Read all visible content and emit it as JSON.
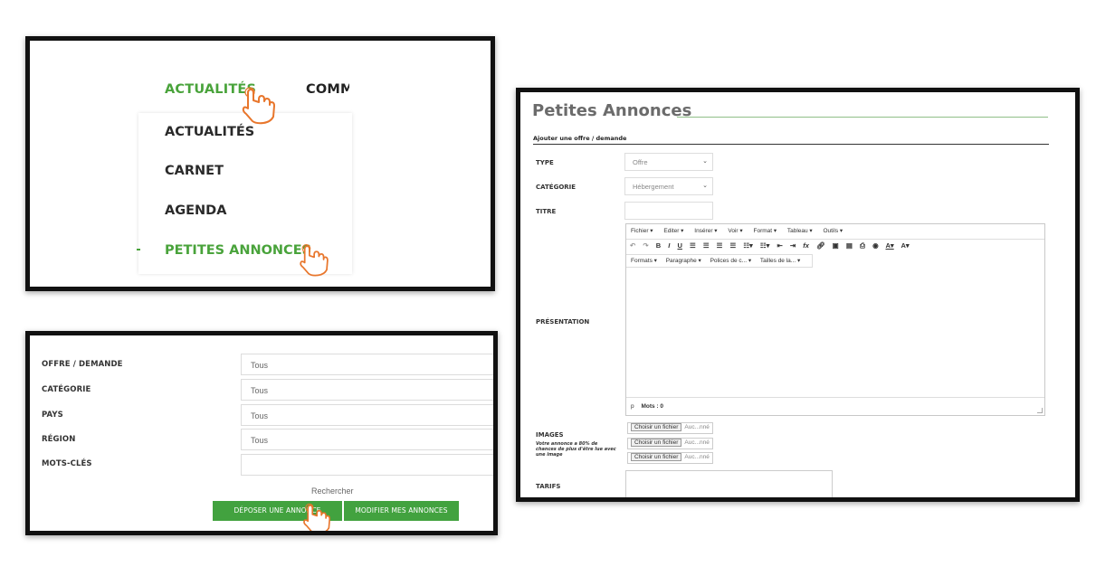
{
  "menu": {
    "top_items": [
      "ACTUALITÉS",
      "COMM"
    ],
    "dropdown_items": [
      "ACTUALITÉS",
      "CARNET",
      "AGENDA",
      "PETITES ANNONCES"
    ]
  },
  "search_form": {
    "fields": [
      {
        "label": "OFFRE / DEMANDE",
        "value": "Tous"
      },
      {
        "label": "CATÉGORIE",
        "value": "Tous"
      },
      {
        "label": "PAYS",
        "value": "Tous"
      },
      {
        "label": "RÉGION",
        "value": "Tous"
      },
      {
        "label": "MOTS-CLÉS",
        "value": ""
      }
    ],
    "search_label": "Rechercher",
    "deposit_button": "DÉPOSER UNE ANNONCE",
    "modify_button": "MODIFIER MES ANNONCES"
  },
  "annonce_form": {
    "title": "Petites Annonces",
    "subtitle": "Ajouter une offre / demande",
    "type_label": "TYPE",
    "type_value": "Offre",
    "category_label": "CATÉGORIE",
    "category_value": "Hébergement",
    "titre_label": "TITRE",
    "presentation_label": "PRÉSENTATION",
    "editor_menus": [
      "Fichier ▾",
      "Editer ▾",
      "Insérer ▾",
      "Voir ▾",
      "Format ▾",
      "Tableau ▾",
      "Outils ▾"
    ],
    "editor_format_menus": [
      "Formats ▾",
      "Paragraphe ▾",
      "Polices de c... ▾",
      "Tailles de la... ▾"
    ],
    "editor_status_tag": "p",
    "editor_word_count": "Mots : 0",
    "images_label": "IMAGES",
    "images_note": "Votre annonce a 80% de chances de plus d'être lue avec une image",
    "file_button": "Choisir un fichier",
    "file_none": "Auc...nné",
    "tarifs_label": "TARIFS"
  },
  "colors": {
    "accent_green": "#49a33b",
    "button_green": "#42a23f",
    "cursor_orange": "#e8762c"
  }
}
